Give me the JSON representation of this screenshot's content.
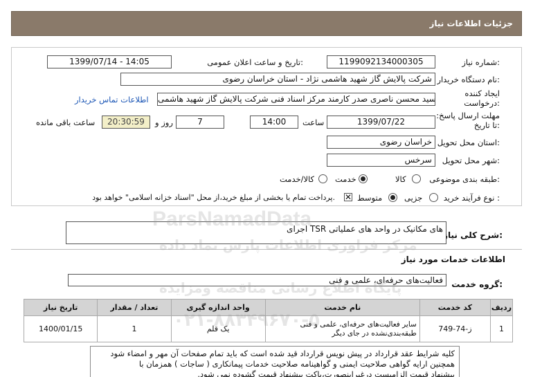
{
  "header": {
    "title": "جزئیات اطلاعات نیاز"
  },
  "form": {
    "need_number_label": "شماره نیاز:",
    "need_number": "1199092134000305",
    "announce_label": "تاریخ و ساعت اعلان عمومی:",
    "announce_value": "1399/07/14 - 14:05",
    "buyer_label": "نام دستگاه خریدار:",
    "buyer_value": "شرکت پالایش گاز شهید هاشمی نژاد - استان خراسان رضوی",
    "creator_label": "ایجاد کننده درخواست:",
    "creator_value": "سید محسن  ناصری صدر کارمند مرکز اسناد فنی شرکت پالایش گاز شهید هاشمی",
    "contact_link": "اطلاعات تماس خریدار",
    "deadline_label": "مهلت ارسال پاسخ: تا تاریخ:",
    "deadline_date": "1399/07/22",
    "time_label": "ساعت",
    "deadline_time": "14:00",
    "days_value": "7",
    "days_label": "روز و",
    "remaining_time": "20:30:59",
    "remaining_label": "ساعت باقی مانده",
    "province_label": "استان محل تحویل:",
    "province_value": "خراسان رضوی",
    "city_label": "شهر محل تحویل:",
    "city_value": "سرخس",
    "category_label": "طبقه بندی موضوعی:",
    "category_options": [
      "کالا",
      "خدمت",
      "کالا/خدمت"
    ],
    "category_selected": "خدمت",
    "process_label": "نوع فرآیند خرید :",
    "process_options": [
      "جزیی",
      "متوسط"
    ],
    "process_selected": "متوسط",
    "treasury_text": "پرداخت تمام یا بخشی از مبلغ خرید،از محل \"اسناد خزانه اسلامی\" خواهد بود."
  },
  "description": {
    "label": "شرح کلی نیاز:",
    "value": "اجرای TSR های مکانیک در واحد های عملیاتی"
  },
  "services_section": {
    "title": "اطلاعات خدمات مورد نیاز",
    "group_label": "گروه خدمت:",
    "group_value": "فعالیت‌های حرفه‌ای، علمی و فنی"
  },
  "table": {
    "headers": [
      "ردیف",
      "کد خدمت",
      "نام خدمت",
      "واحد اندازه گیری",
      "تعداد / مقدار",
      "تاریخ نیاز"
    ],
    "rows": [
      {
        "index": "1",
        "code": "ز-74-749",
        "name": "سایر فعالیت‌های حرفه‌ای، علمی و فنی طبقه‌بندی‌نشده در جای دیگر",
        "unit": "یک قلم",
        "qty": "1",
        "date": "1400/01/15"
      }
    ]
  },
  "notes": {
    "line1": "کلیه شرایط عقد قرارداد در پیش نویس قرارداد قید شده است که باید تمام صفحات آن مهر و امضاء شود",
    "line2": "همچنین ارایه گواهی صلاحیت ایمنی و گواهینامه صلاحیت خدمات پیمانکاری ( ساجات ) همزمان با",
    "line3": "پیشنهاد قیمت الزامیست درغیراینصورت،پاکت پیشنهاد قیمت گشوده نمی شود."
  },
  "watermark": {
    "line1": "ParsNamadData",
    "line2": "مرکز فراوری اطلاعات پارس نماد داده",
    "line3": "پایگاه اطلاع رسانی مناقصه ومزایده",
    "line4": "۰۲۱-۸۸۳۴۹۶۷۰-۵"
  },
  "colors": {
    "header_bg": "#8a7a6a",
    "link": "#1a55b5",
    "remaining_bg": "#f3efc8",
    "table_header_bg": "#d4d4d4"
  }
}
